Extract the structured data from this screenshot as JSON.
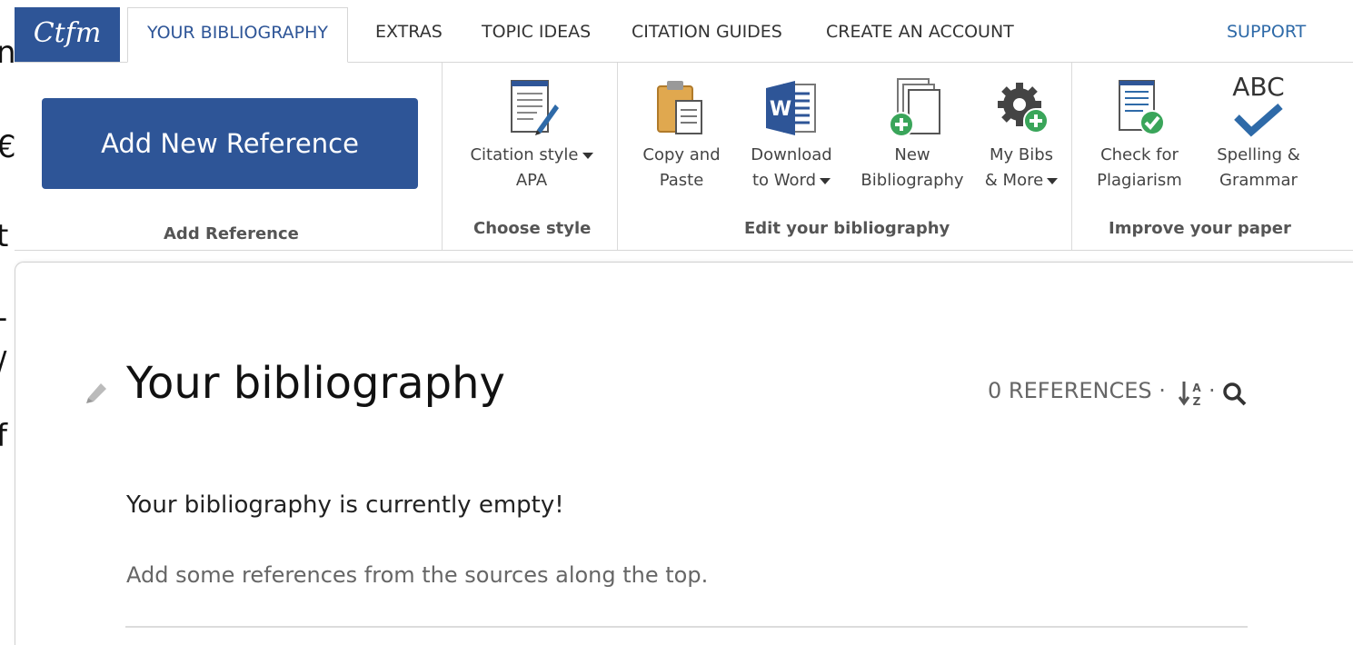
{
  "left_edge": [
    "n",
    "€",
    "t",
    "-",
    "/",
    "f"
  ],
  "nav": {
    "logo": "Ctfm",
    "tabs": [
      "YOUR BIBLIOGRAPHY",
      "EXTRAS",
      "TOPIC IDEAS",
      "CITATION GUIDES",
      "CREATE AN ACCOUNT"
    ],
    "support": "SUPPORT"
  },
  "ribbon": {
    "add_button": "Add New Reference",
    "groups": {
      "add": "Add Reference",
      "style": "Choose style",
      "edit": "Edit your bibliography",
      "improve": "Improve your paper"
    },
    "citation_style": {
      "line1": "Citation style",
      "line2": "APA"
    },
    "copy_paste": {
      "line1": "Copy and",
      "line2": "Paste"
    },
    "download": {
      "line1": "Download",
      "line2": "to Word"
    },
    "new_bib": {
      "line1": "New",
      "line2": "Bibliography"
    },
    "my_bibs": {
      "line1": "My Bibs",
      "line2": "& More"
    },
    "plagiarism": {
      "line1": "Check for",
      "line2": "Plagiarism"
    },
    "spelling": {
      "icon_text": "ABC",
      "line1": "Spelling &",
      "line2": "Grammar"
    }
  },
  "main": {
    "title": "Your bibliography",
    "ref_count": "0 REFERENCES",
    "sep": "·",
    "empty_title": "Your bibliography is currently empty!",
    "empty_hint": "Add some references from the sources along the top."
  },
  "colors": {
    "brand": "#2e5597",
    "support_link": "#2e6aa8",
    "check_green": "#3aa55a"
  }
}
